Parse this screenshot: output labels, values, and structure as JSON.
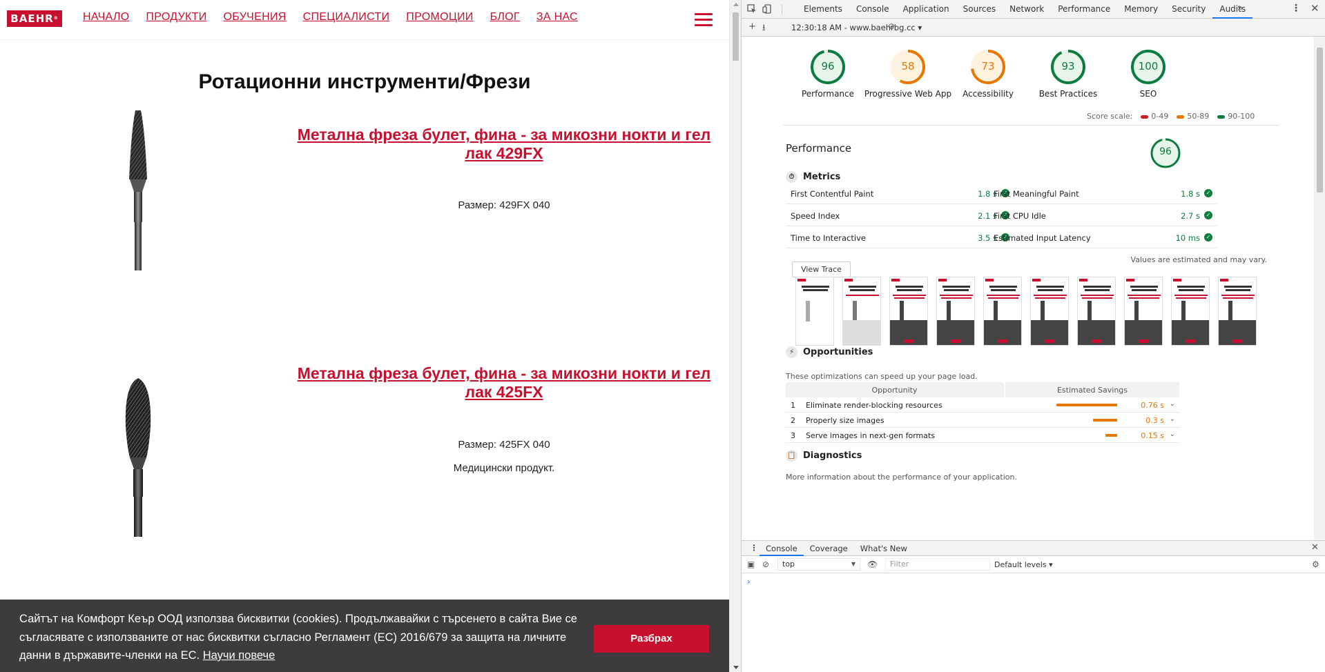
{
  "site": {
    "logo": "BAEHR",
    "logo_mark": "®",
    "nav": [
      "НАЧАЛО",
      "ПРОДУКТИ",
      "ОБУЧЕНИЯ",
      "СПЕЦИАЛИСТИ",
      "ПРОМОЦИИ",
      "БЛОГ",
      "ЗА НАС"
    ],
    "page_title": "Ротационни инструменти/Фрези",
    "products": [
      {
        "title": "Метална фреза булет, фина - за микозни нокти и гел лак 429FX",
        "size": "Размер: 429FX 040",
        "note": ""
      },
      {
        "title": "Метална фреза булет, фина - за микозни нокти и гел лак 425FX",
        "size": "Размер: 425FX 040",
        "note": "Медицински продукт."
      }
    ],
    "cookie": {
      "text": "Сайтът на Комфорт Кеър ООД използва бисквитки (cookies). Продължавайки с търсенето в сайта Вие се съгласявате с използваните от нас бисквитки съгласно Регламент (ЕС) 2016/679 за защита на личните данни в държавите-членки на ЕС.",
      "link": "Научи повече",
      "button": "Разбрах"
    },
    "brand_color": "#c8102e"
  },
  "devtools": {
    "tabs": [
      "Elements",
      "Console",
      "Application",
      "Sources",
      "Network",
      "Performance",
      "Memory",
      "Security",
      "Audits"
    ],
    "active_tab": "Audits",
    "toolbar_url": "12:30:18 AM - www.baehrbg.cc",
    "gauges": [
      {
        "label": "Performance",
        "score": 96,
        "color": "#0d7d3f"
      },
      {
        "label": "Progressive Web App",
        "score": 58,
        "color": "#e67700"
      },
      {
        "label": "Accessibility",
        "score": 73,
        "color": "#e67700"
      },
      {
        "label": "Best Practices",
        "score": 93,
        "color": "#0d7d3f"
      },
      {
        "label": "SEO",
        "score": 100,
        "color": "#0d7d3f"
      }
    ],
    "score_scale": {
      "label": "Score scale:",
      "ranges": [
        {
          "label": "0-49",
          "color": "#c7221f"
        },
        {
          "label": "50-89",
          "color": "#e67700"
        },
        {
          "label": "90-100",
          "color": "#0d7d3f"
        }
      ]
    },
    "performance": {
      "title": "Performance",
      "score": 96,
      "metrics_head": "Metrics",
      "metrics": [
        {
          "name": "First Contentful Paint",
          "value": "1.8 s"
        },
        {
          "name": "First Meaningful Paint",
          "value": "1.8 s"
        },
        {
          "name": "Speed Index",
          "value": "2.1 s"
        },
        {
          "name": "First CPU Idle",
          "value": "2.7 s"
        },
        {
          "name": "Time to Interactive",
          "value": "3.5 s"
        },
        {
          "name": "Estimated Input Latency",
          "value": "10 ms"
        }
      ],
      "view_trace": "View Trace",
      "estimated_note": "Values are estimated and may vary.",
      "opportunities_head": "Opportunities",
      "opportunities_desc": "These optimizations can speed up your page load.",
      "opp_col1": "Opportunity",
      "opp_col2": "Estimated Savings",
      "opportunities": [
        {
          "idx": "1",
          "name": "Eliminate render-blocking resources",
          "savings": "0.76 s",
          "seconds": 0.76
        },
        {
          "idx": "2",
          "name": "Properly size images",
          "savings": "0.3 s",
          "seconds": 0.3
        },
        {
          "idx": "3",
          "name": "Serve images in next-gen formats",
          "savings": "0.15 s",
          "seconds": 0.15
        }
      ],
      "diagnostics_head": "Diagnostics",
      "diagnostics_desc": "More information about the performance of your application."
    },
    "drawer": {
      "tabs": [
        "Console",
        "Coverage",
        "What's New"
      ],
      "active": "Console",
      "context": "top",
      "filter_placeholder": "Filter",
      "levels": "Default levels",
      "prompt": "›"
    }
  }
}
